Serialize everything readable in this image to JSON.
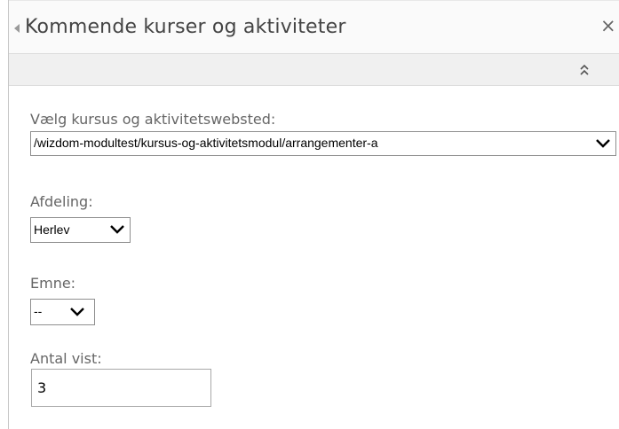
{
  "webpart": {
    "title": "Kommende kurser og aktiviteter",
    "close_symbol": "×"
  },
  "fields": {
    "site": {
      "label": "Vælg kursus og aktivitetswebsted:",
      "value": "/wizdom-modultest/kursus-og-aktivitetsmodul/arrangementer-a"
    },
    "department": {
      "label": "Afdeling:",
      "value": "Herlev"
    },
    "topic": {
      "label": "Emne:",
      "value": "--"
    },
    "count": {
      "label": "Antal vist:",
      "value": "3"
    }
  },
  "icons": {
    "collapse": "caret-left-icon",
    "close": "close-icon",
    "chevron": "double-chevron-up-icon",
    "dropdown": "chevron-down-icon"
  }
}
